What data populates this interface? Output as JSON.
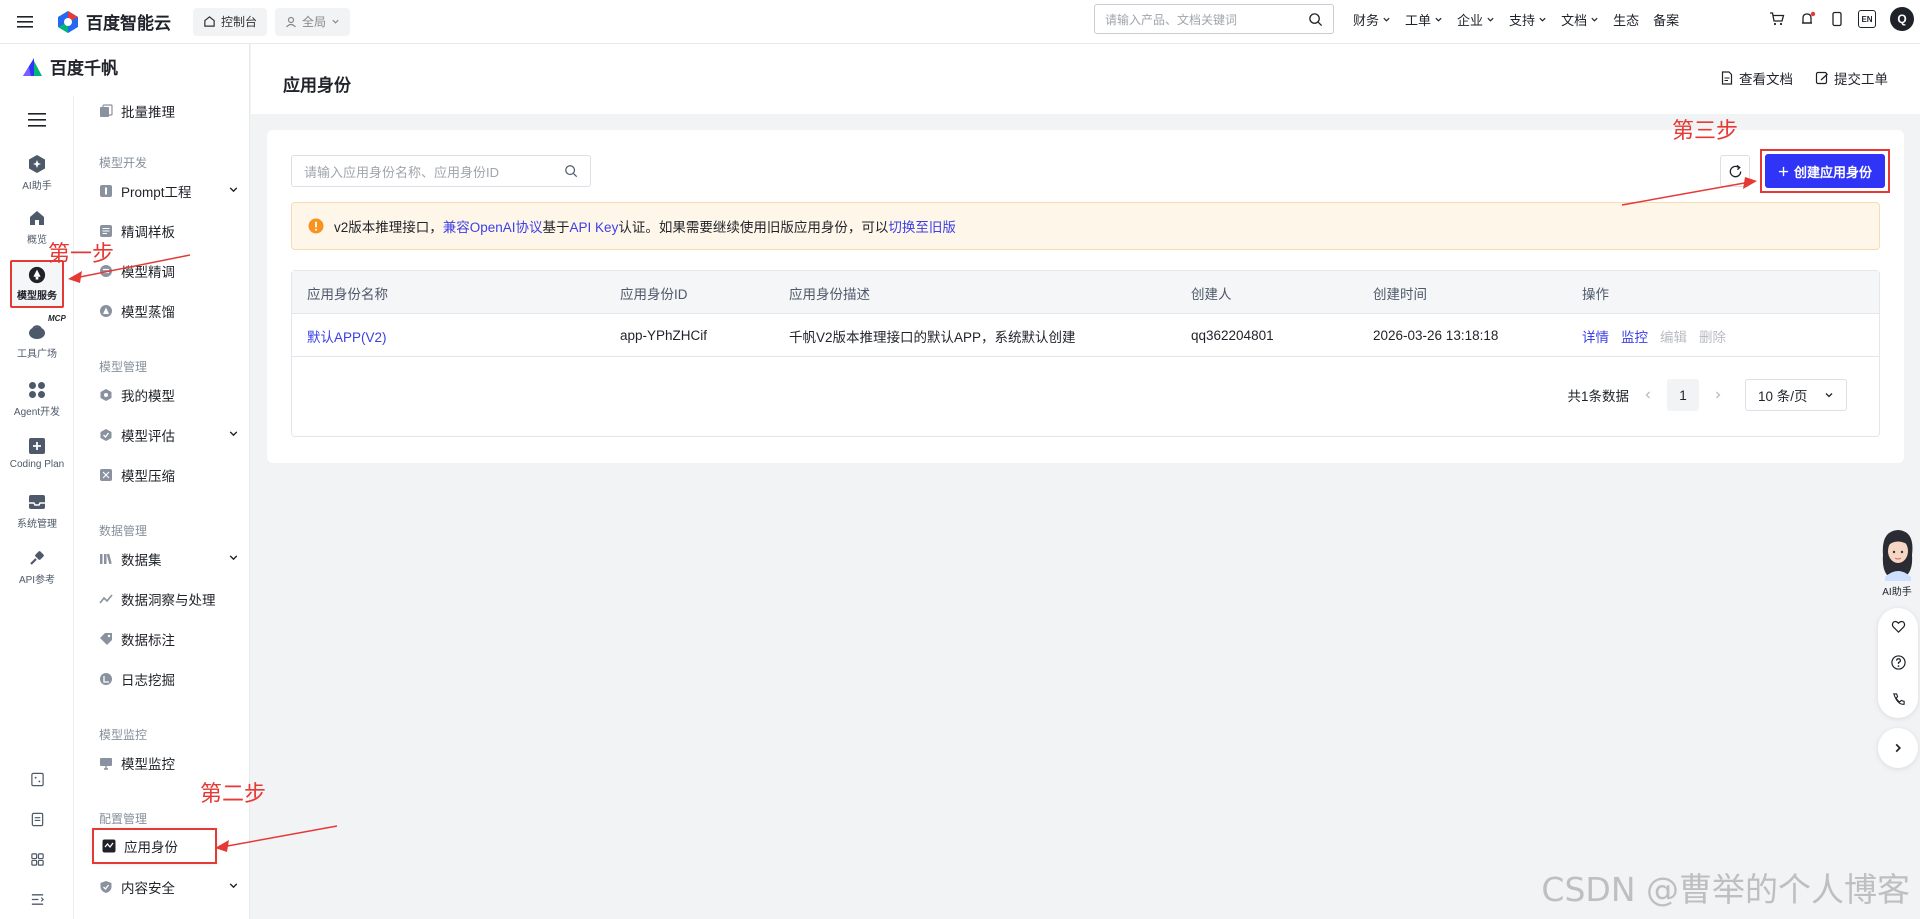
{
  "topbar": {
    "logo_text": "百度智能云",
    "console_label": "控制台",
    "region_label": "全局",
    "search_placeholder": "请输入产品、文档关键词",
    "nav": [
      "财务",
      "工单",
      "企业",
      "支持",
      "文档",
      "生态",
      "备案"
    ],
    "lang_label": "EN",
    "avatar_letter": "Q"
  },
  "sidebar": {
    "brand": "百度千帆",
    "rail": [
      {
        "label": "AI助手",
        "icon": "ai-assistant-icon"
      },
      {
        "label": "概览",
        "icon": "home-icon"
      },
      {
        "label": "模型服务",
        "icon": "model-service-icon",
        "active": true
      },
      {
        "label": "工具广场",
        "icon": "tool-square-icon",
        "badge": "MCP"
      },
      {
        "label": "Agent开发",
        "icon": "grid-icon"
      },
      {
        "label": "Coding Plan",
        "icon": "code-plus-icon"
      },
      {
        "label": "系统管理",
        "icon": "inbox-icon"
      },
      {
        "label": "API参考",
        "icon": "api-icon"
      }
    ],
    "menu": {
      "top_item": "批量推理",
      "group_dev": "模型开发",
      "dev_items": [
        "Prompt工程",
        "精调样板",
        "模型精调",
        "模型蒸馏"
      ],
      "group_manage": "模型管理",
      "manage_items": [
        "我的模型",
        "模型评估",
        "模型压缩"
      ],
      "group_data": "数据管理",
      "data_items": [
        "数据集",
        "数据洞察与处理",
        "数据标注",
        "日志挖掘"
      ],
      "group_monitor": "模型监控",
      "monitor_items": [
        "模型监控"
      ],
      "group_config": "配置管理",
      "config_items": [
        "应用身份",
        "内容安全"
      ]
    }
  },
  "page": {
    "title": "应用身份",
    "view_docs": "查看文档",
    "submit_ticket": "提交工单",
    "search_placeholder": "请输入应用身份名称、应用身份ID",
    "create_button": "创建应用身份",
    "alert": {
      "part1": "v2版本推理接口，",
      "link1": "兼容OpenAI协议",
      "part2": "基于",
      "link2": "API Key",
      "part3": "认证。如果需要继续使用旧版应用身份，可以",
      "link3": "切换至旧版"
    },
    "table": {
      "columns": [
        "应用身份名称",
        "应用身份ID",
        "应用身份描述",
        "创建人",
        "创建时间",
        "操作"
      ],
      "rows": [
        {
          "name": "默认APP(V2)",
          "id": "app-YPhZHCif",
          "desc": "千帆V2版本推理接口的默认APP，系统默认创建",
          "creator": "qq362204801",
          "created": "2026-03-26 13:18:18",
          "actions": [
            "详情",
            "监控",
            "编辑",
            "删除"
          ]
        }
      ]
    },
    "pagination": {
      "total": "共1条数据",
      "current": "1",
      "page_size": "10 条/页"
    }
  },
  "floating": {
    "ai_label": "AI助手"
  },
  "annotations": {
    "step1": "第一步",
    "step2": "第二步",
    "step3": "第三步"
  },
  "watermark": "CSDN @曹举的个人博客",
  "colors": {
    "primary": "#2f34f7",
    "link": "#3a3fe6",
    "annotation_red": "#e53935",
    "alert_bg": "#fff6ea",
    "alert_icon": "#f7931e"
  }
}
